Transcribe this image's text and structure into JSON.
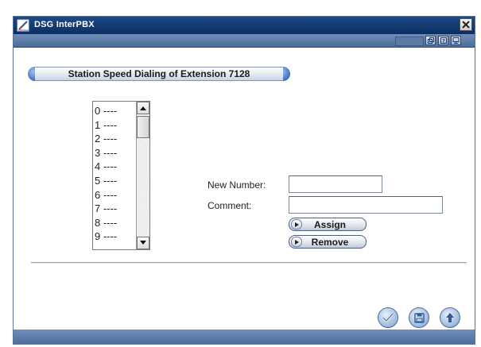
{
  "window": {
    "title": "DSG InterPBX"
  },
  "icons": {
    "app": "pen-logo-icon",
    "close": "close-icon",
    "toolbar": [
      "restore-window-icon",
      "help-icon",
      "monitor-icon"
    ],
    "ok": "checkmark-icon",
    "save": "floppy-disk-icon",
    "up": "arrow-up-icon"
  },
  "section": {
    "title": "Station Speed Dialing of Extension 7128"
  },
  "speed_dial_list": {
    "items": [
      "0 ----",
      "1 ----",
      "2 ----",
      "3 ----",
      "4 ----",
      "5 ----",
      "6 ----",
      "7 ----",
      "8 ----",
      "9 ----"
    ]
  },
  "form": {
    "new_number_label": "New Number:",
    "new_number_value": "",
    "comment_label": "Comment:",
    "comment_value": "",
    "assign_label": "Assign",
    "remove_label": "Remove"
  },
  "colors": {
    "titlebar": "#0b2e62",
    "toolbar": "#5a7aa6",
    "accent": "#3b6fbf"
  }
}
